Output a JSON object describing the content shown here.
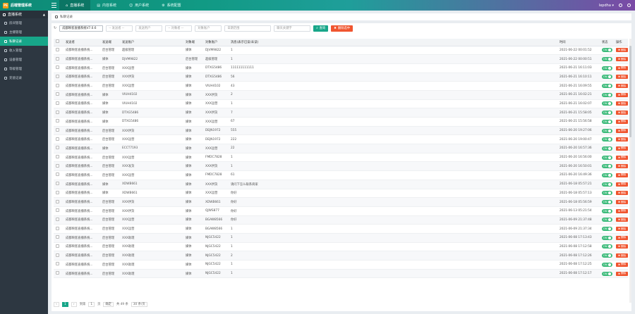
{
  "app": {
    "logo_badge": "PE",
    "title": "后端管理系统"
  },
  "topnav": [
    {
      "label": "直播系统",
      "icon": "home-icon",
      "active": true
    },
    {
      "label": "内容系统",
      "icon": "file-icon",
      "active": false
    },
    {
      "label": "用户系统",
      "icon": "user-icon",
      "active": false
    },
    {
      "label": "系统配置",
      "icon": "gear-icon",
      "active": false
    }
  ],
  "user": {
    "name": "lepdha ▾"
  },
  "sidebar": {
    "header": "直播系统",
    "items": [
      {
        "label": "房间管理",
        "active": false
      },
      {
        "label": "主播管理",
        "active": false
      },
      {
        "label": "私聊记录",
        "active": true
      },
      {
        "label": "收入管理",
        "active": false
      },
      {
        "label": "设备管理",
        "active": false
      },
      {
        "label": "等级管理",
        "active": false
      },
      {
        "label": "充值记录",
        "active": false
      }
    ]
  },
  "breadcrumb": {
    "label": "私聊记录"
  },
  "filters": {
    "app_select": "成都映客直播系统V7.0.6",
    "sel2": "-- 发送者 --",
    "inp3": "发送用户",
    "sel4": "-- 对象者 --",
    "inp5": "对象账户",
    "inp6": "日期范围",
    "inp7": "聊天关键字",
    "search_label": "查询",
    "delete_label": "删除选中"
  },
  "table": {
    "headers": [
      "",
      "发送者",
      "发送端",
      "发送账户",
      "",
      "对象端",
      "对象账户",
      "消息(表示已读/未读)",
      "",
      "时间",
      "状态",
      "操作"
    ],
    "rows": [
      [
        "成都映客直播系统...",
        "后台管理",
        "超级管理",
        "",
        "媒体",
        "DJVM9822",
        "1",
        "2021-06-22 00:01:52"
      ],
      [
        "成都映客直播系统...",
        "媒体",
        "DJVM9822",
        "",
        "后台管理",
        "超级管理",
        "1",
        "2021-06-22 00:00:51"
      ],
      [
        "成都映客直播系统...",
        "后台管理",
        "XXX运营",
        "",
        "媒体",
        "DTXG5486",
        "111111111111",
        "2021-06-21 16:11:03"
      ],
      [
        "成都映客直播系统...",
        "后台管理",
        "XXX供货",
        "",
        "媒体",
        "DTXG5486",
        "56",
        "2021-06-21 16:10:11"
      ],
      [
        "成都映客直播系统...",
        "后台管理",
        "XXX运营",
        "",
        "媒体",
        "VIUH4102",
        "43",
        "2021-06-21 16:09:55"
      ],
      [
        "成都映客直播系统...",
        "媒体",
        "VIUH4102",
        "",
        "媒体",
        "XXX供货",
        "2",
        "2021-06-21 16:02:21"
      ],
      [
        "成都映客直播系统...",
        "媒体",
        "VIUH4102",
        "",
        "媒体",
        "XXX运营",
        "1",
        "2021-06-21 16:02:07"
      ],
      [
        "成都映客直播系统...",
        "媒体",
        "DTXG5486",
        "",
        "媒体",
        "XXX供货",
        "7",
        "2021-06-21 15:58:05"
      ],
      [
        "成都映客直播系统...",
        "媒体",
        "DTXG5486",
        "",
        "媒体",
        "XXX运营",
        "67",
        "2021-06-21 15:56:58"
      ],
      [
        "成都映客直播系统...",
        "后台管理",
        "XXX供货",
        "",
        "媒体",
        "DEJN1972",
        "555",
        "2021-06-20 19:27:06"
      ],
      [
        "成都映客直播系统...",
        "后台管理",
        "XXX运营",
        "",
        "媒体",
        "DEJN1972",
        "222",
        "2021-06-20 19:00:47"
      ],
      [
        "成都映客直播系统...",
        "媒体",
        "ECCT7193",
        "",
        "媒体",
        "XXX运营",
        "22",
        "2021-06-20 16:57:36"
      ],
      [
        "成都映客直播系统...",
        "后台管理",
        "XXX运营",
        "",
        "媒体",
        "FMDC7828",
        "1",
        "2021-06-20 16:56:00"
      ],
      [
        "成都映客直播系统...",
        "后台管理",
        "XXX发货",
        "",
        "媒体",
        "XXX供货",
        "1",
        "2021-06-20 16:50:01"
      ],
      [
        "成都映客直播系统...",
        "后台管理",
        "XXX运营",
        "",
        "媒体",
        "FMDC7828",
        "61",
        "2021-06-20 16:49:36"
      ],
      [
        "成都映客直播系统...",
        "媒体",
        "XDWB661",
        "",
        "媒体",
        "XXX供货",
        "请问下怎么联系商家",
        "2021-06-18 05:57:21"
      ],
      [
        "成都映客直播系统...",
        "媒体",
        "XDWB661",
        "",
        "媒体",
        "XXX运营",
        "你好",
        "2021-06-18 05:57:13"
      ],
      [
        "成都映客直播系统...",
        "后台管理",
        "XXX供货",
        "",
        "媒体",
        "XDWB661",
        "你好",
        "2021-06-18 05:56:59"
      ],
      [
        "成都映客直播系统...",
        "后台管理",
        "XXX供货",
        "",
        "媒体",
        "QJWS877",
        "你好",
        "2021-06-13 05:21:54"
      ],
      [
        "成都映客直播系统...",
        "后台管理",
        "XXX运营",
        "",
        "媒体",
        "BGAW8566",
        "你好",
        "2021-06-09 21:37:48"
      ],
      [
        "成都映客直播系统...",
        "后台管理",
        "XXX运营",
        "",
        "媒体",
        "BGAW8566",
        "1",
        "2021-06-09 21:37:34"
      ],
      [
        "成都映客直播系统...",
        "后台管理",
        "XXX助理",
        "",
        "媒体",
        "NJGC5422",
        "1",
        "2021-06-08 17:13:43"
      ],
      [
        "成都映客直播系统...",
        "后台管理",
        "XXX助理",
        "",
        "媒体",
        "NJGC5422",
        "1",
        "2021-06-08 17:12:58"
      ],
      [
        "成都映客直播系统...",
        "后台管理",
        "XXX助理",
        "",
        "媒体",
        "NJGC5422",
        "2",
        "2021-06-08 17:12:26"
      ],
      [
        "成都映客直播系统...",
        "后台管理",
        "XXX助理",
        "",
        "媒体",
        "NJGC5422",
        "1",
        "2021-06-08 17:12:25"
      ],
      [
        "成都映客直播系统...",
        "后台管理",
        "XXX助理",
        "",
        "媒体",
        "NJGC5422",
        "1",
        "2021-06-08 17:12:17"
      ]
    ],
    "status_label": "ON",
    "op_label": "删除"
  },
  "pager": {
    "prev": "‹",
    "cur": "1",
    "next": "›",
    "goto_label": "到第",
    "page_value": "1",
    "page_unit": "页",
    "confirm": "确定",
    "total": "共 49 条",
    "page_size": "30 条/页"
  }
}
